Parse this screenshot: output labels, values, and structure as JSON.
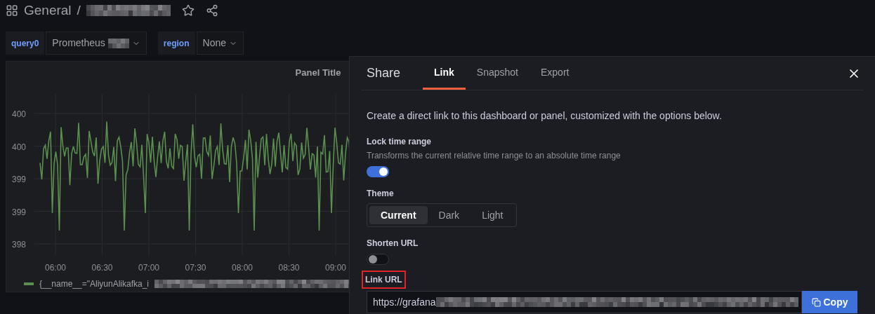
{
  "header": {
    "folder": "General",
    "separator": "/",
    "title_redacted": true,
    "starred": false
  },
  "variables": [
    {
      "label": "query0",
      "value": "Prometheus",
      "redacted": true
    },
    {
      "label": "region",
      "value": "None",
      "redacted": false
    }
  ],
  "panel": {
    "title": "Panel Title",
    "yticks": [
      "400",
      "400",
      "399",
      "399",
      "398"
    ],
    "xticks": [
      "06:00",
      "06:30",
      "07:00",
      "07:30",
      "08:00",
      "08:30",
      "09:00"
    ],
    "legend": {
      "text": "{__name__=\"AliyunAlikafka_i",
      "color": "#5a8f4e",
      "redacted": true
    }
  },
  "share": {
    "title": "Share",
    "tabs": [
      {
        "label": "Link",
        "selected": true
      },
      {
        "label": "Snapshot",
        "selected": false
      },
      {
        "label": "Export",
        "selected": false
      }
    ],
    "description": "Create a direct link to this dashboard or panel, customized with the options below.",
    "lock_time_range": {
      "label": "Lock time range",
      "description": "Transforms the current relative time range to an absolute time range",
      "on": true
    },
    "theme": {
      "label": "Theme",
      "options": [
        {
          "label": "Current",
          "selected": true
        },
        {
          "label": "Dark",
          "selected": false
        },
        {
          "label": "Light",
          "selected": false
        }
      ]
    },
    "shorten_url": {
      "label": "Shorten URL",
      "on": false
    },
    "link_url": {
      "label": "Link URL",
      "highlighted": true,
      "value": "https://grafana",
      "redacted": true,
      "button": "Copy"
    }
  }
}
